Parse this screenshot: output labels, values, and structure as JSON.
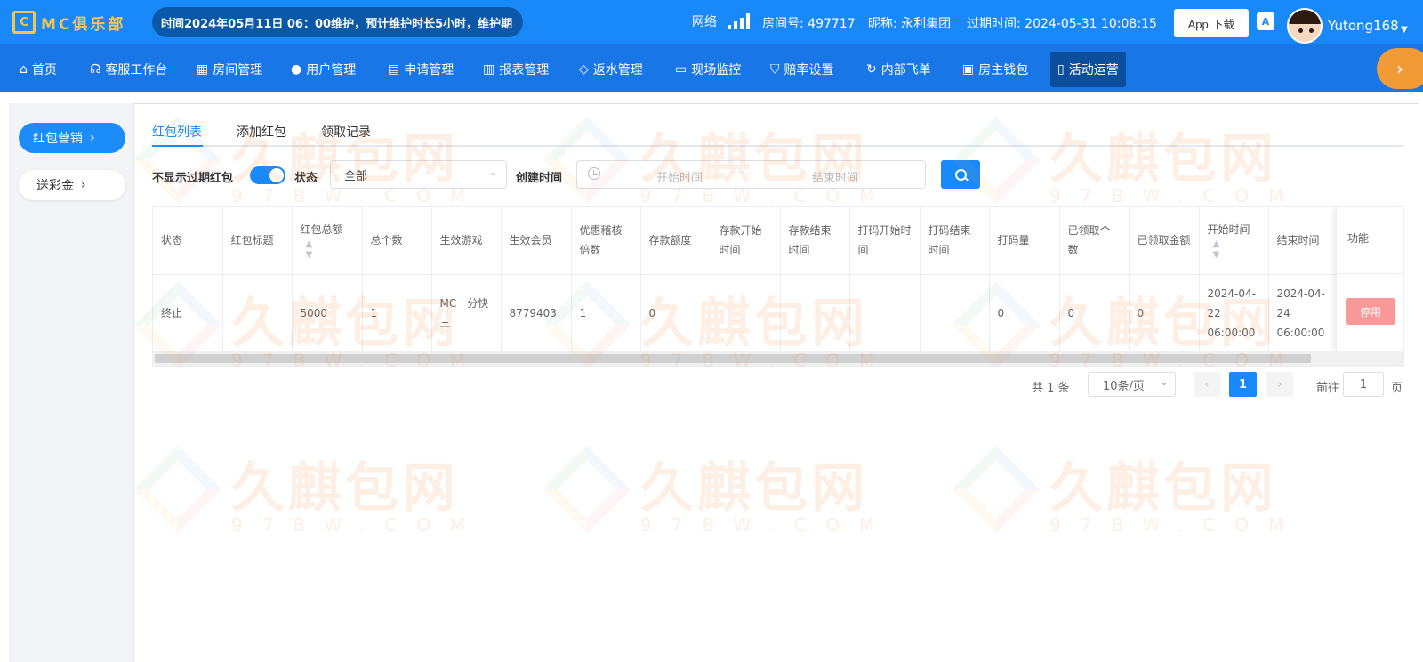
{
  "header": {
    "logo_text": "MC俱乐部",
    "notice": "时间2024年05月11日 06：00维护，预计维护时长5小时，维护期",
    "network_label": "网络",
    "room_label": "房间号: 497717",
    "nickname": "昵称: 永利集团",
    "expire": "过期时间: 2024-05-31 10:08:15",
    "app_download": "App 下载",
    "lang_icon": "translate-icon",
    "username": "Yutong168"
  },
  "nav": {
    "items": [
      {
        "label": "首页",
        "icon": "home-icon"
      },
      {
        "label": "客服工作台",
        "icon": "headset-icon"
      },
      {
        "label": "房间管理",
        "icon": "grid-icon"
      },
      {
        "label": "用户管理",
        "icon": "user-icon"
      },
      {
        "label": "申请管理",
        "icon": "document-icon"
      },
      {
        "label": "报表管理",
        "icon": "bar-chart-icon"
      },
      {
        "label": "返水管理",
        "icon": "tag-icon"
      },
      {
        "label": "现场监控",
        "icon": "monitor-icon"
      },
      {
        "label": "赔率设置",
        "icon": "shield-icon"
      },
      {
        "label": "内部飞单",
        "icon": "refresh-icon"
      },
      {
        "label": "房主钱包",
        "icon": "wallet-icon"
      },
      {
        "label": "活动运营",
        "icon": "coupon-icon"
      }
    ],
    "active_index": 11
  },
  "sidebar": {
    "items": [
      {
        "label": "红包营销"
      },
      {
        "label": "送彩金"
      }
    ]
  },
  "tabs": [
    "红包列表",
    "添加红包",
    "领取记录"
  ],
  "filters": {
    "hide_expired_label": "不显示过期红包",
    "hide_expired_on": true,
    "status_label": "状态",
    "status_value": "全部",
    "created_label": "创建时间",
    "start_placeholder": "开始时间",
    "separator": "-",
    "end_placeholder": "结束时间"
  },
  "table": {
    "columns": [
      "状态",
      "红包标题",
      "红包总额",
      "总个数",
      "生效游戏",
      "生效会员",
      "优惠稽核倍数",
      "存款额度",
      "存款开始时间",
      "存款结束时间",
      "打码开始时间",
      "打码结束时间",
      "打码量",
      "已领取个数",
      "已领取金额",
      "开始时间",
      "结束时间",
      "功能"
    ],
    "rows": [
      [
        "终止",
        "",
        "5000",
        "1",
        "MC一分快三",
        "8779403",
        "1",
        "0",
        "",
        "",
        "",
        "",
        "0",
        "0",
        "0",
        "2024-04-22 06:00:00",
        "2024-04-24 06:00:00"
      ]
    ],
    "action_label": "停用"
  },
  "pagination": {
    "total": "共 1 条",
    "page_size": "10条/页",
    "current_page": "1",
    "goto_label": "前往",
    "goto_value": "1",
    "goto_suffix": "页"
  },
  "watermark": {
    "name": "久麒包网",
    "url": "97BW.COM"
  },
  "colors": {
    "primary": "#1989fa",
    "nav_bg": "#1976e7",
    "active_nav": "#0b4f9c",
    "danger_light": "#f89898"
  }
}
